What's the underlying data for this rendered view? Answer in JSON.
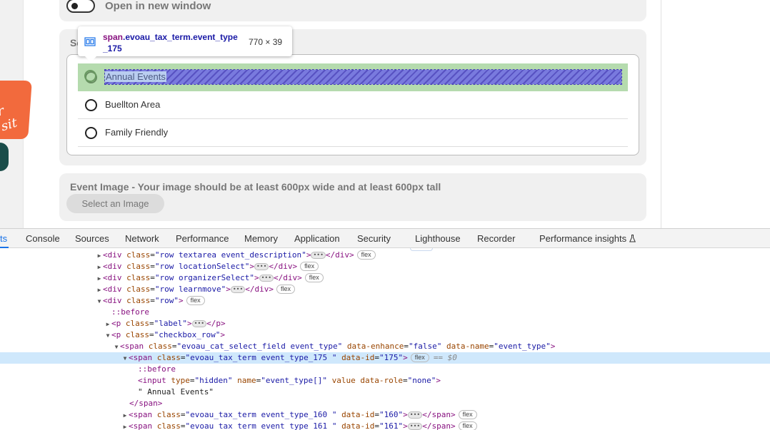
{
  "page": {
    "promo_text": "r\nsit",
    "open_window": {
      "label": "Open in new window",
      "checked": false
    },
    "event_type": {
      "section_label": "Se",
      "options": [
        {
          "label": "Annual Events",
          "selected": false
        },
        {
          "label": "Buellton Area",
          "selected": false
        },
        {
          "label": "Family Friendly",
          "selected": false
        }
      ]
    },
    "event_image": {
      "label": "Event Image - Your image should be at least 600px wide and at least 600px tall",
      "button": "Select an Image"
    }
  },
  "inspector_tooltip": {
    "tag": "span",
    "classes": ".evoau_tax_term.event_type_175",
    "size": "770 × 39"
  },
  "devtools": {
    "tabs": [
      "ts",
      "Console",
      "Sources",
      "Network",
      "Performance",
      "Memory",
      "Application",
      "Security",
      "Lighthouse",
      "Recorder",
      "Performance insights"
    ],
    "active_tab": "ts",
    "dom": {
      "l1": {
        "tag": "div",
        "class": "row textarea event_description",
        "badge": "flex"
      },
      "l2": {
        "tag": "div",
        "class": "row locationSelect",
        "badge": "flex"
      },
      "l3": {
        "tag": "div",
        "class": "row organizerSelect",
        "badge": "flex"
      },
      "l4": {
        "tag": "div",
        "class": "row learnmove",
        "badge": "flex"
      },
      "l5": {
        "tag": "div",
        "class": "row",
        "badge": "flex"
      },
      "l6": {
        "pseudo": "::before"
      },
      "l7": {
        "tag": "p",
        "class": "label"
      },
      "l8": {
        "tag": "p",
        "class": "checkbox_row"
      },
      "l9": {
        "tag": "span",
        "class": "evoau_cat_select_field event_type",
        "enhance": "false",
        "dname": "event_type"
      },
      "l10": {
        "tag": "span",
        "class": "evoau_tax_term event_type_175 ",
        "id": "175",
        "badge": "flex",
        "console_ref": "== $0"
      },
      "l11": {
        "pseudo": "::before"
      },
      "l12": {
        "tag": "input",
        "type": "hidden",
        "name": "event_type[]",
        "role": "none"
      },
      "l13": {
        "text": "\" Annual Events\""
      },
      "l14": {
        "close": "</span>"
      },
      "l15": {
        "tag": "span",
        "class": "evoau_tax_term event_type_160 ",
        "id": "160",
        "badge": "flex"
      },
      "l16": {
        "tag": "span",
        "class": "evoau_tax_term event_type_161 ",
        "id": "161",
        "badge": "flex"
      }
    }
  }
}
